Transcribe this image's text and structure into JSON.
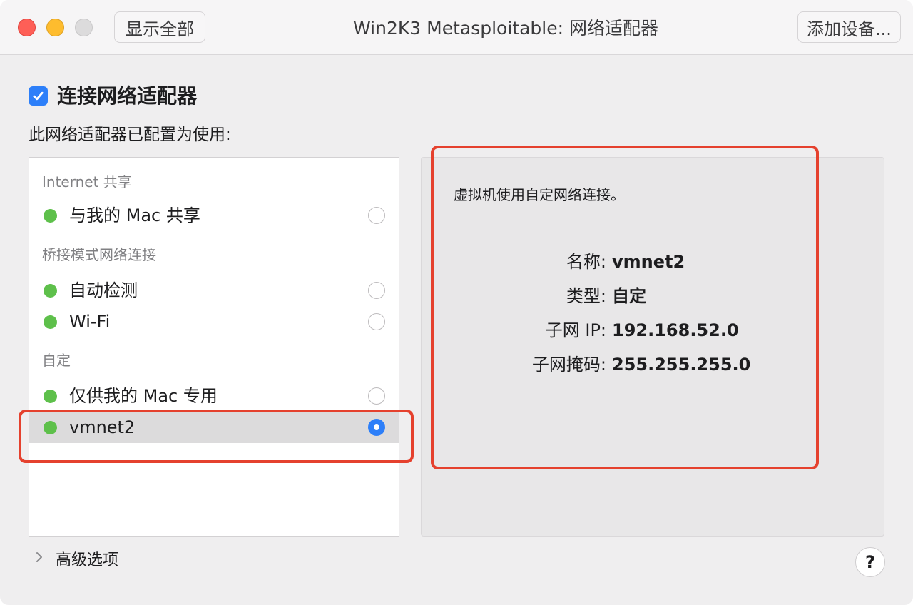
{
  "window": {
    "title": "Win2K3 Metasploitable: 网络适配器",
    "show_all_button": "显示全部",
    "add_device_button": "添加设备..."
  },
  "connect": {
    "checked": true,
    "label": "连接网络适配器"
  },
  "configured_label": "此网络适配器已配置为使用:",
  "list": {
    "groups": [
      {
        "header": "Internet 共享",
        "items": [
          {
            "label": "与我的 Mac 共享",
            "status": "green",
            "selected": false
          }
        ]
      },
      {
        "header": "桥接模式网络连接",
        "items": [
          {
            "label": "自动检测",
            "status": "green",
            "selected": false
          },
          {
            "label": "Wi-Fi",
            "status": "green",
            "selected": false
          }
        ]
      },
      {
        "header": "自定",
        "items": [
          {
            "label": "仅供我的 Mac 专用",
            "status": "green",
            "selected": false
          },
          {
            "label": "vmnet2",
            "status": "green",
            "selected": true
          }
        ]
      }
    ]
  },
  "detail": {
    "intro": "虚拟机使用自定网络连接。",
    "fields": [
      {
        "key": "名称:",
        "value": "vmnet2"
      },
      {
        "key": "类型:",
        "value": "自定"
      },
      {
        "key": "子网 IP:",
        "value": "192.168.52.0"
      },
      {
        "key": "子网掩码:",
        "value": "255.255.255.0"
      }
    ]
  },
  "advanced_label": "高级选项",
  "help_label": "?",
  "colors": {
    "accent": "#2d7ff9",
    "status_green": "#5ec04b",
    "highlight": "#e5412e"
  },
  "icons": {
    "checkbox": "checkmark-icon",
    "advanced": "chevron-right-icon",
    "status": "status-dot-icon"
  }
}
